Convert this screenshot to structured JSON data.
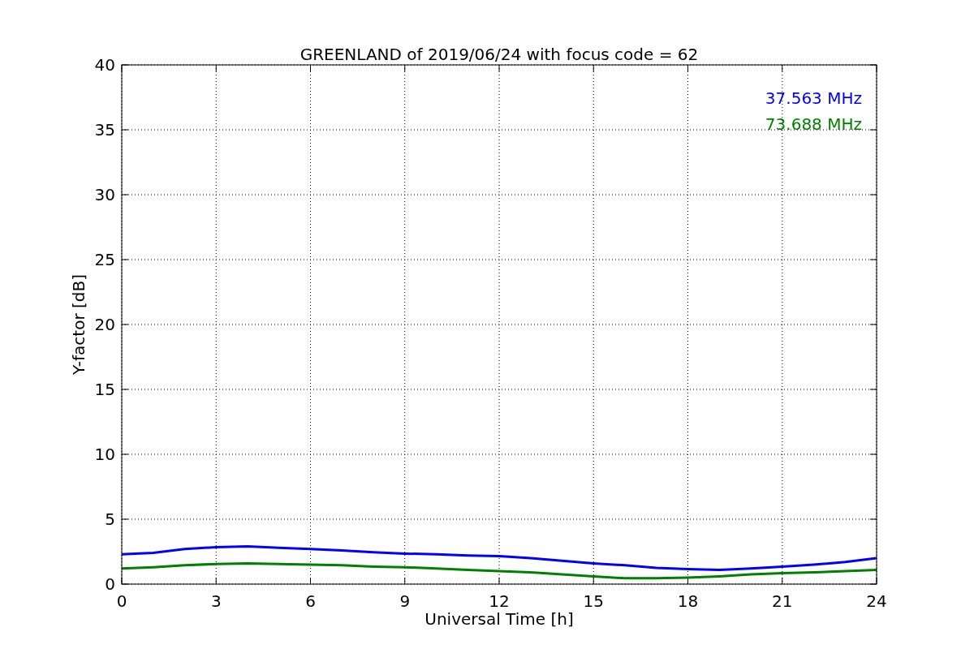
{
  "chart_data": {
    "type": "line",
    "title": "GREENLAND of 2019/06/24 with focus code = 62",
    "xlabel": "Universal Time [h]",
    "ylabel": "Y-factor [dB]",
    "x": [
      0,
      1,
      2,
      3,
      4,
      5,
      6,
      7,
      8,
      9,
      10,
      11,
      12,
      13,
      14,
      15,
      16,
      17,
      18,
      19,
      20,
      21,
      22,
      23,
      24
    ],
    "series": [
      {
        "name": "37.563 MHz",
        "color": "#0000ff",
        "values": [
          2.3,
          2.4,
          2.7,
          2.85,
          2.9,
          2.8,
          2.7,
          2.6,
          2.45,
          2.35,
          2.3,
          2.2,
          2.15,
          2.0,
          1.8,
          1.6,
          1.45,
          1.25,
          1.15,
          1.1,
          1.2,
          1.35,
          1.5,
          1.7,
          2.0
        ]
      },
      {
        "name": "73.688 MHz",
        "color": "#008000",
        "values": [
          1.2,
          1.3,
          1.45,
          1.55,
          1.6,
          1.55,
          1.5,
          1.45,
          1.35,
          1.3,
          1.2,
          1.1,
          1.0,
          0.9,
          0.75,
          0.6,
          0.45,
          0.45,
          0.5,
          0.6,
          0.75,
          0.85,
          0.9,
          1.0,
          1.1
        ]
      }
    ],
    "xlim": [
      0,
      24
    ],
    "ylim": [
      0,
      40
    ],
    "xticks": [
      0,
      3,
      6,
      9,
      12,
      15,
      18,
      21,
      24
    ],
    "yticks": [
      0,
      5,
      10,
      15,
      20,
      25,
      30,
      35,
      40
    ],
    "grid": true
  }
}
